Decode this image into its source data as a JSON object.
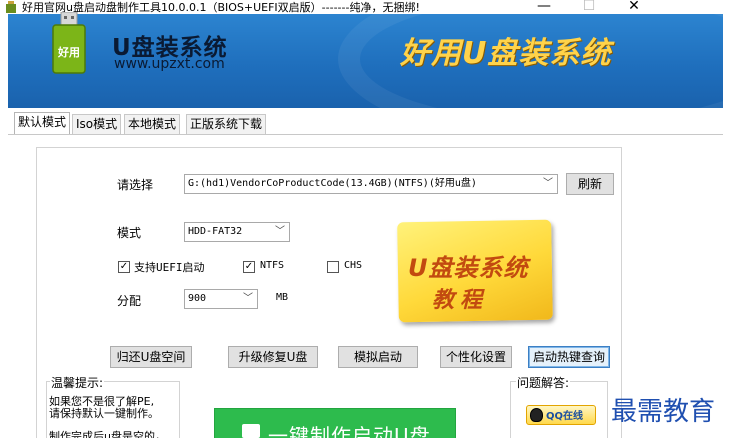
{
  "window": {
    "title": "好用官网u盘启动盘制作工具10.0.0.1（BIOS+UEFI双启版）-------纯净，无捆绑!",
    "minimize": "—",
    "maximize": "☐",
    "close": "✕"
  },
  "banner": {
    "brand_name": "U盘装系统",
    "brand_url": "www.upzxt.com",
    "logo_text": "好用",
    "slogan": "好用U盘装系统"
  },
  "tabs": [
    {
      "label": "默认模式",
      "active": true
    },
    {
      "label": "Iso模式",
      "active": false
    },
    {
      "label": "本地模式",
      "active": false
    },
    {
      "label": "正版系统下载",
      "active": false
    }
  ],
  "form": {
    "select_label": "请选择",
    "drive_value": "G:(hd1)VendorCoProductCode(13.4GB)(NTFS)(好用u盘)",
    "refresh_label": "刷新",
    "mode_label": "模式",
    "mode_value": "HDD-FAT32",
    "uefi_label": "支持UEFI启动",
    "uefi_checked": true,
    "ntfs_label": "NTFS",
    "ntfs_checked": true,
    "chs_label": "CHS",
    "chs_checked": false,
    "alloc_label": "分配",
    "alloc_value": "900",
    "alloc_unit": "MB"
  },
  "tutorial": {
    "line1": "U盘装系统",
    "line2": "教程"
  },
  "actions": {
    "restore": "归还U盘空间",
    "upgrade": "升级修复U盘",
    "simulate": "模拟启动",
    "customize": "个性化设置",
    "hotkey": "启动热键查询"
  },
  "tips": {
    "title": "温馨提示:",
    "line1": "如果您不是很了解PE,",
    "line2": "请保持默认一键制作。",
    "line3": "制作完成后u盘是空的，"
  },
  "make_button": "一键制作启动U盘",
  "help": {
    "title": "问题解答:",
    "qq_label": "QQ在线"
  },
  "watermark": "最需教育",
  "colors": {
    "banner_blue": "#1f6fbd",
    "slogan_yellow": "#ffd34a",
    "make_green": "#2dbb4d",
    "watermark_blue": "#1f4fb0"
  }
}
